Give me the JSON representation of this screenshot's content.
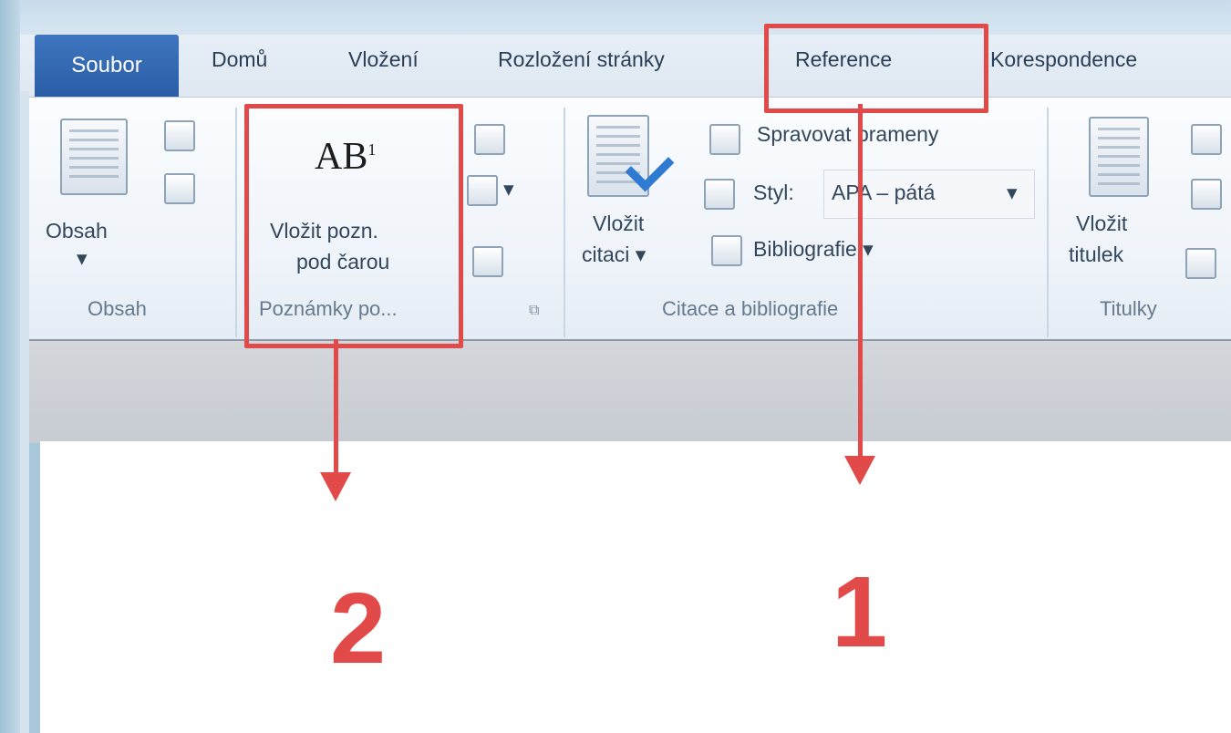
{
  "tabs": {
    "file": "Soubor",
    "items": [
      "Domů",
      "Vložení",
      "Rozložení stránky",
      "Reference",
      "Korespondence"
    ]
  },
  "ribbon": {
    "toc": {
      "button": "Obsah",
      "dropdown": "▾",
      "group": "Obsah"
    },
    "footnotes": {
      "icon_text": "AB",
      "icon_sup": "1",
      "button_line1": "Vložit pozn.",
      "button_line2": "pod čarou",
      "group": "Poznámky po...",
      "launcher": "⧉",
      "small_btn_dd": "▾"
    },
    "citations": {
      "button_line1": "Vložit",
      "button_line2": "citaci ▾",
      "manage": "Spravovat prameny",
      "style_label": "Styl:",
      "style_value": "APA – pátá",
      "style_dd": "▾",
      "bibliography": "Bibliografie ▾",
      "group": "Citace a bibliografie"
    },
    "captions": {
      "button_line1": "Vložit",
      "button_line2": "titulek",
      "group": "Titulky"
    }
  },
  "annotations": {
    "step1": "1",
    "step2": "2",
    "color": "#e24a4a"
  }
}
